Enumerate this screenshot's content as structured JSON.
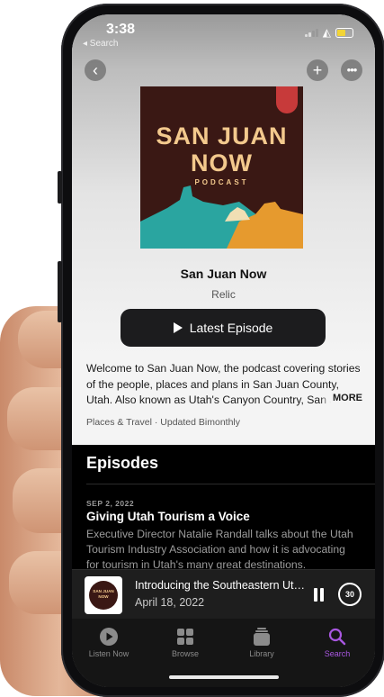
{
  "status": {
    "time": "3:38",
    "back_label": "◂ Search"
  },
  "nav": {
    "back_icon": "chevron-left-icon",
    "add_icon": "plus-icon",
    "more_icon": "ellipsis-icon"
  },
  "artwork": {
    "line1": "SAN JUAN",
    "line2": "NOW",
    "sub": "PODCAST"
  },
  "podcast": {
    "title": "San Juan Now",
    "author": "Relic",
    "latest_label": "Latest Episode",
    "description": "Welcome to San Juan Now, the podcast covering stories of the people, places and plans in San Juan County, Utah. Also known as Utah's Canyon Country, San Juan County",
    "more_label": "MORE",
    "meta": "Places & Travel · Updated Bimonthly"
  },
  "episodes": {
    "header": "Episodes",
    "items": [
      {
        "date": "SEP 2, 2022",
        "title": "Giving Utah Tourism a Voice",
        "description": "Executive Director Natalie Randall talks about the Utah Tourism Industry Association and how it is advocating for tourism in Utah's many great destinations."
      }
    ]
  },
  "mini_player": {
    "art_text": "SAN JUAN NOW",
    "title": "Introducing the Southeastern Utah Podcast",
    "date": "April 18, 2022",
    "skip_label": "30"
  },
  "tabs": [
    {
      "label": "Listen Now",
      "icon": "play-circle-icon"
    },
    {
      "label": "Browse",
      "icon": "grid-icon"
    },
    {
      "label": "Library",
      "icon": "stack-icon"
    },
    {
      "label": "Search",
      "icon": "magnifier-icon",
      "active": true
    }
  ],
  "colors": {
    "accent": "#a857e0",
    "artwork_bg": "#3a1814",
    "artwork_text": "#f3c98d"
  }
}
